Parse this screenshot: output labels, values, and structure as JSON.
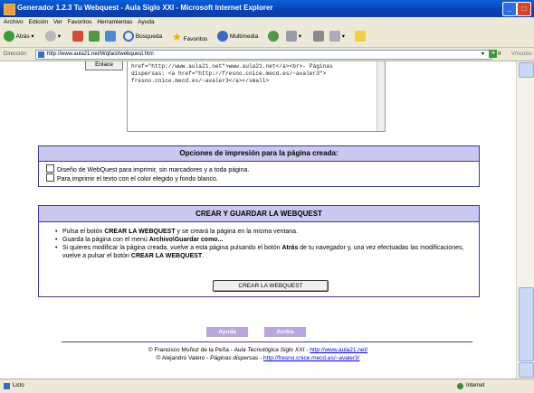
{
  "window": {
    "title": "Generador 1.2.3 Tu Webquest - Aula Siglo XXI - Microsoft Internet Explorer",
    "minimize": "_",
    "maximize": "□"
  },
  "menu": [
    "Archivo",
    "Edición",
    "Ver",
    "Favoritos",
    "Herramientas",
    "Ayuda"
  ],
  "toolbar": {
    "back": "Atrás",
    "search": "Búsqueda",
    "favorites": "Favoritos",
    "multimedia": "Multimedia"
  },
  "address": {
    "label": "Dirección",
    "url": "http://www.aula21.net/Wqfacil/webquest.htm",
    "go": "Ir",
    "links": "Vínculos"
  },
  "page": {
    "enlace_button": "Enlace",
    "code_lines": [
      "href=\"http://www.aula21.net\">www.aula21.net</a><br>- Páginas",
      "dispersas: <a href=\"http://fresno.cnice.mecd.es/~avaler3\">",
      "fresno.cnice.mecd.es/~avaler3</a></small>"
    ],
    "print_options": {
      "heading": "Opciones de impresión para la página creada:",
      "option1": "Diseño de WebQuest para imprimir, sin marcadores y a toda página.",
      "option2": "Para imprimir el texto con el color elegido y fondo blanco."
    },
    "create": {
      "heading": "CREAR Y GUARDAR LA WEBQUEST",
      "b1_a": "Pulsa el botón ",
      "b1_b": "CREAR LA WEBQUEST",
      "b1_c": " y se creará la página en la misma ventana.",
      "b2_a": "Guarda la página con el menú ",
      "b2_b": "Archivo\\Guardar como...",
      "b3_a": "Si quieres modificar la página creada, vuelve a esta página pulsando el botón ",
      "b3_b": "Atrás",
      "b3_c": " de tu navegador y, una vez efectuadas las modificaciones, vuelve a pulsar el botón ",
      "b3_d": "CREAR LA WEBQUEST",
      "b3_e": ".",
      "button": "CREAR LA WEBQUEST"
    },
    "nav": {
      "help": "Ayuda",
      "top": "Arriba"
    },
    "footer": {
      "l1_a": "© Francisco Muñoz de la Peña - ",
      "l1_b": "Aula Tecnológica Siglo XXI",
      "l1_c": " - ",
      "l1_link": "http://www.aula21.net/",
      "l2_a": "© Alejandro Valero - ",
      "l2_b": "Páginas dispersas",
      "l2_c": " - ",
      "l2_link": "http://fresno.cnice.mecd.es/~avaler3/"
    }
  },
  "status": {
    "left": "Listo",
    "zone": "Internet"
  },
  "colors": {
    "panel_border": "#3a3aa0",
    "panel_header": "#c8c8f0",
    "nav_button": "#b9a5e0",
    "titlebar": "#0a5fd8"
  }
}
